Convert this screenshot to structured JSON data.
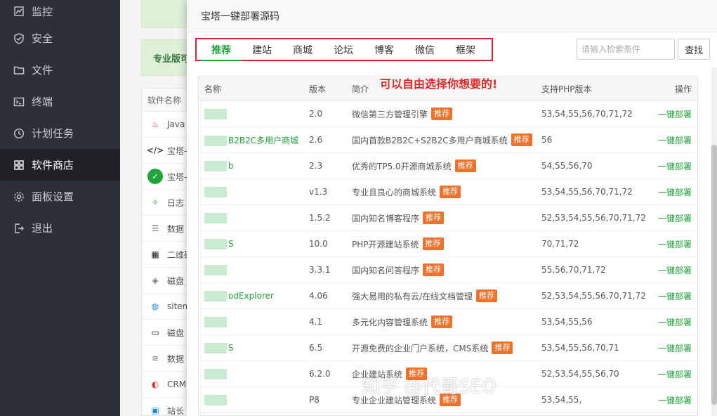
{
  "sidebar": {
    "items": [
      {
        "label": "监控",
        "icon": "monitor-icon"
      },
      {
        "label": "安全",
        "icon": "shield-icon"
      },
      {
        "label": "文件",
        "icon": "folder-icon"
      },
      {
        "label": "终端",
        "icon": "terminal-icon"
      },
      {
        "label": "计划任务",
        "icon": "clock-icon"
      },
      {
        "label": "软件商店",
        "icon": "grid-icon",
        "active": true
      },
      {
        "label": "面板设置",
        "icon": "gear-icon"
      },
      {
        "label": "退出",
        "icon": "logout-icon"
      }
    ]
  },
  "background": {
    "banner_text": "专业版可",
    "list_header": "软件名称",
    "rows": [
      "Java",
      "宝塔-",
      "宝塔-",
      "日志",
      "数据",
      "二维码",
      "磁盘",
      "sitem",
      "磁盘",
      "数据",
      "CRM",
      "站长"
    ]
  },
  "modal": {
    "title": "宝塔一键部署源码",
    "tabs": [
      "推荐",
      "建站",
      "商城",
      "论坛",
      "博客",
      "微信",
      "框架"
    ],
    "active_tab": "推荐",
    "search_placeholder": "请输入检索条件",
    "search_button": "查找",
    "annotation": "可以自由选择你想要的!",
    "table": {
      "headers": {
        "name": "名称",
        "version": "版本",
        "desc": "简介",
        "php": "支持PHP版本",
        "op": "操作"
      },
      "badge": "推荐",
      "op_label": "一键部署",
      "rows": [
        {
          "name": "",
          "version": "2.0",
          "desc": "微信第三方管理引擎",
          "php": "53,54,55,56,70,71,72"
        },
        {
          "name": "B2B2C多用户商城",
          "version": "2.6",
          "desc": "国内首款B2B2C+S2B2C多用户商城系统",
          "php": "56"
        },
        {
          "name": "b",
          "version": "2.3",
          "desc": "优秀的TP5.0开源商城系统",
          "php": "54,55,56,70"
        },
        {
          "name": "",
          "version": "v1.3",
          "desc": "专业且良心的商城系统",
          "php": "53,54,55,56,70,71,72"
        },
        {
          "name": "",
          "version": "1.5.2",
          "desc": "国内知名博客程序",
          "php": "52,53,54,55,56,70,71,72"
        },
        {
          "name": "S",
          "version": "10.0",
          "desc": "PHP开源建站系统",
          "php": "70,71,72"
        },
        {
          "name": "",
          "version": "3.3.1",
          "desc": "国内知名问答程序",
          "php": "55,56,70,71,72"
        },
        {
          "name": "odExplorer",
          "version": "4.06",
          "desc": "强大易用的私有云/在线文档管理",
          "php": "52,53,54,55,56,70,71,72"
        },
        {
          "name": "",
          "version": "4.1",
          "desc": "多元化内容管理系统",
          "php": "53,54,55,56"
        },
        {
          "name": "S",
          "version": "6.5",
          "desc": "开源免费的企业门户系统，CMS系统",
          "php": "53,54,55,56,70,71"
        },
        {
          "name": "",
          "version": "6.2.0",
          "desc": "企业建站系统",
          "php": "52,53,54,55,56,70"
        },
        {
          "name": "",
          "version": "P8",
          "desc": "专业企业建站管理系统",
          "php": "53,54,55,"
        }
      ]
    }
  },
  "watermark": "知乎 @代哥SEO",
  "colors": {
    "accent": "#20a53a",
    "badge": "#f0712c",
    "annotation": "#e02828",
    "sidebar": "#2d3038"
  }
}
